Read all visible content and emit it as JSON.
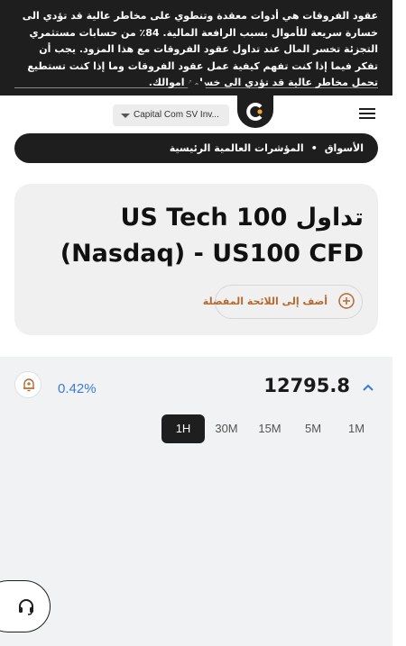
{
  "risk_banner": {
    "text": "عقود الفروقات هي أدوات معقدة وتنطوي على مخاطر عالية قد تؤدي الى خسارة سريعة للأموال بسبب الرافعة المالية. 84٪ من حسابات مستثمري التجزئة تخسر المال عند تداول عقود الفروقات مع هذا المزود. يجب أن تفكر فيما إذا كنت تفهم كيفية عمل عقود الفروقات وما إذا كنت تستطيع تحمل مخاطر عالية قد تؤدي الى خسارة اموالك.",
    "collapse_icon": "chevron-up-icon"
  },
  "header": {
    "entity_selector": "Capital Com SV Inv...",
    "logo_icon": "capital-com-logo",
    "menu_icon": "hamburger-menu-icon"
  },
  "breadcrumb": {
    "items": [
      "الأسواق",
      "المؤشرات العالمية الرئيسية"
    ],
    "separator": "•"
  },
  "instrument": {
    "title": "تداول US Tech 100 (Nasdaq) - US100 CFD",
    "favorite_label": "أضف إلى اللائحة المفضلة",
    "favorite_icon": "plus-circle-icon"
  },
  "quote": {
    "price": "12795.8",
    "change": "0.42%",
    "direction_icon": "chevron-up-icon",
    "alert_icon": "bell-plus-icon",
    "accent_color": "#3a7bd5",
    "timeframes": [
      "1H",
      "30M",
      "15M",
      "5M",
      "1M"
    ],
    "active_timeframe": "1H"
  },
  "support": {
    "icon": "headset-icon"
  },
  "colors": {
    "dark": "#1e1e1e",
    "card_bg": "#f0f0f0",
    "favorite_text": "#b46a2f",
    "logo_accent": "#f5a623"
  }
}
